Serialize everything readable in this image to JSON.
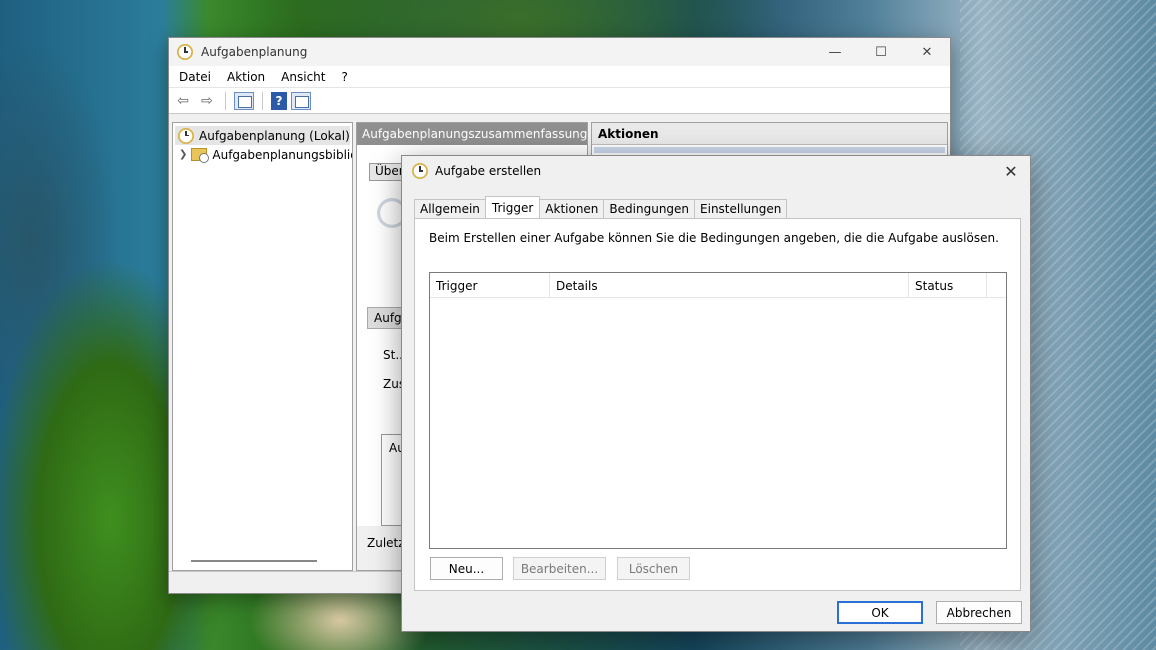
{
  "main_window": {
    "title": "Aufgabenplanung",
    "controls": {
      "minimize": "—",
      "maximize": "☐",
      "close": "✕"
    },
    "menu": [
      "Datei",
      "Aktion",
      "Ansicht",
      "?"
    ],
    "toolbar": {
      "back": "⇦",
      "forward": "⇨",
      "help": "?"
    },
    "tree": {
      "root": "Aufgabenplanung (Lokal)",
      "child": "Aufgabenplanungsbibliothek"
    },
    "center": {
      "header": "Aufgabenplanungszusammenfassung (letzte Aktualisierung",
      "box1": "Übersicht",
      "box2": "Aufgabenstatus",
      "line1": "St...",
      "line2": "Zus...",
      "box3": "Au...",
      "footer": "Zuletzt aktualisiert"
    },
    "actions_header": "Aktionen"
  },
  "dialog": {
    "title": "Aufgabe erstellen",
    "close": "✕",
    "tabs": [
      "Allgemein",
      "Trigger",
      "Aktionen",
      "Bedingungen",
      "Einstellungen"
    ],
    "active_tab": "Trigger",
    "description": "Beim Erstellen einer Aufgabe können Sie die Bedingungen angeben, die die Aufgabe auslösen.",
    "columns": [
      "Trigger",
      "Details",
      "Status"
    ],
    "buttons": {
      "new": "Neu...",
      "edit": "Bearbeiten...",
      "delete": "Löschen"
    },
    "ok": "OK",
    "cancel": "Abbrechen"
  }
}
